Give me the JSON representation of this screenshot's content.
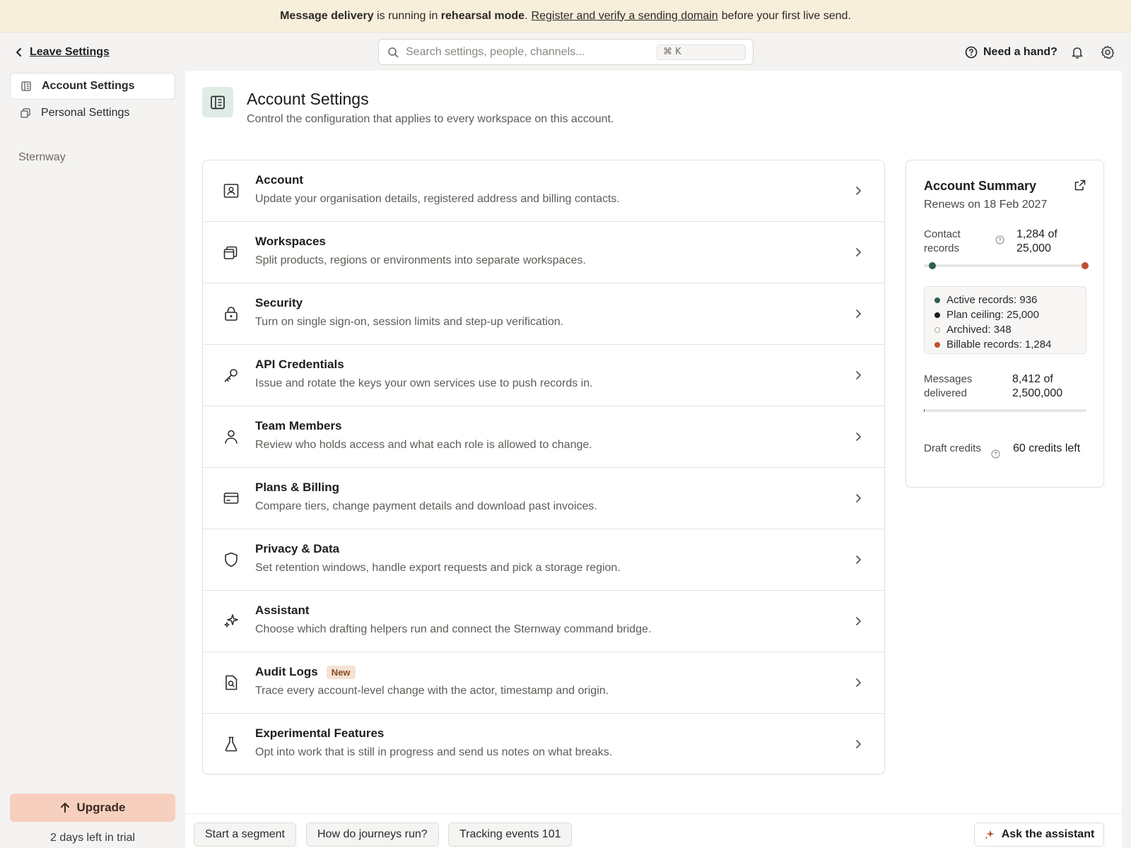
{
  "banner": {
    "part1": "Message delivery",
    "part2": " is running in ",
    "part3": "rehearsal mode",
    "part4": ".",
    "link": "Register and verify a sending domain",
    "part5": "before your first live send."
  },
  "topbar": {
    "back_label": "Leave Settings",
    "search_placeholder": "Search settings, people, channels...",
    "search_shortcut": "⌘ K",
    "help_label": "Need a hand?"
  },
  "sidebar": {
    "items": [
      {
        "label": "Account Settings",
        "icon": "sidebar-layout-icon",
        "active": true
      },
      {
        "label": "Personal Settings",
        "icon": "copy-icon",
        "active": false
      }
    ],
    "group_label": "Sternway",
    "upgrade_label": "Upgrade",
    "trial_text": "2 days left in trial"
  },
  "page": {
    "title": "Account Settings",
    "subtitle": "Control the configuration that applies to every workspace on this account."
  },
  "settings": [
    {
      "title": "Account",
      "desc": "Update your organisation details, registered address and billing contacts.",
      "icon": "id-card-icon"
    },
    {
      "title": "Workspaces",
      "desc": "Split products, regions or environments into separate workspaces.",
      "icon": "stacked-windows-icon"
    },
    {
      "title": "Security",
      "desc": "Turn on single sign-on, session limits and step-up verification.",
      "icon": "lock-icon"
    },
    {
      "title": "API Credentials",
      "desc": "Issue and rotate the keys your own services use to push records in.",
      "icon": "key-icon"
    },
    {
      "title": "Team Members",
      "desc": "Review who holds access and what each role is allowed to change.",
      "icon": "user-icon"
    },
    {
      "title": "Plans & Billing",
      "desc": "Compare tiers, change payment details and download past invoices.",
      "icon": "credit-card-icon"
    },
    {
      "title": "Privacy & Data",
      "desc": "Set retention windows, handle export requests and pick a storage region.",
      "icon": "shield-icon"
    },
    {
      "title": "Assistant",
      "desc": "Choose which drafting helpers run and connect the Sternway command bridge.",
      "icon": "sparkle-icon"
    },
    {
      "title": "Audit Logs",
      "badge": "New",
      "desc": "Trace every account-level change with the actor, timestamp and origin.",
      "icon": "file-search-icon"
    },
    {
      "title": "Experimental Features",
      "desc": "Opt into work that is still in progress and send us notes on what breaks.",
      "icon": "flask-icon"
    }
  ],
  "summary": {
    "title": "Account Summary",
    "renews": "Renews on 18 Feb 2027",
    "contacts_label": "Contact records",
    "contacts_value": "1,284 of 25,000",
    "contacts_fraction": 0.051,
    "legend": [
      {
        "label": "Active records: 936",
        "color": "#2f5e4e"
      },
      {
        "label": "Plan ceiling: 25,000",
        "color": "#1d1d1d"
      },
      {
        "label": "Archived: 348",
        "color": "hollow"
      },
      {
        "label": "Billable records: 1,284",
        "color": "#c0502e"
      }
    ],
    "messages_label": "Messages delivered",
    "messages_value": "8,412 of 2,500,000",
    "messages_fraction": 0.003,
    "credits_label": "Draft credits",
    "credits_value": "60 credits left"
  },
  "footer": {
    "chips": [
      "Start a segment",
      "How do journeys run?",
      "Tracking events 101"
    ],
    "assistant_label": "Ask the assistant"
  }
}
